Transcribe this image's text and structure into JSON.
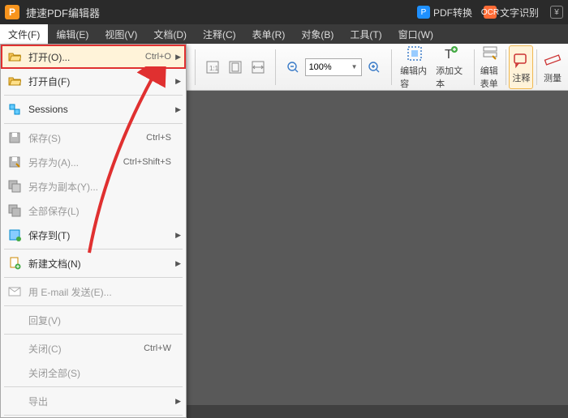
{
  "titlebar": {
    "logo": "P",
    "title": "捷速PDF编辑器",
    "pdf_convert": "PDF转换",
    "ocr": "文字识别",
    "yuan": "¥"
  },
  "menubar": {
    "items": [
      {
        "label": "文件(F)",
        "active": true
      },
      {
        "label": "编辑(E)"
      },
      {
        "label": "视图(V)"
      },
      {
        "label": "文档(D)"
      },
      {
        "label": "注释(C)"
      },
      {
        "label": "表单(R)"
      },
      {
        "label": "对象(B)"
      },
      {
        "label": "工具(T)"
      },
      {
        "label": "窗口(W)"
      }
    ]
  },
  "toolbar": {
    "zoom_value": "100%",
    "edit_content": "编辑内容",
    "add_text": "添加文本",
    "edit_form": "编辑表单",
    "annotate": "注释",
    "measure": "测量"
  },
  "dropdown": {
    "items": [
      {
        "icon": "folder-open-icon",
        "label": "打开(O)...",
        "shortcut": "Ctrl+O",
        "arrow": true,
        "highlight": true
      },
      {
        "icon": "folder-open-icon",
        "label": "打开自(F)",
        "arrow": true
      },
      {
        "sep": true
      },
      {
        "icon": "sessions-icon",
        "label": "Sessions",
        "arrow": true
      },
      {
        "sep": true
      },
      {
        "icon": "save-icon",
        "label": "保存(S)",
        "shortcut": "Ctrl+S",
        "gray": true
      },
      {
        "icon": "save-as-icon",
        "label": "另存为(A)...",
        "shortcut": "Ctrl+Shift+S",
        "gray": true
      },
      {
        "icon": "save-copy-icon",
        "label": "另存为副本(Y)...",
        "gray": true
      },
      {
        "icon": "save-all-icon",
        "label": "全部保存(L)",
        "gray": true
      },
      {
        "icon": "save-to-icon",
        "label": "保存到(T)",
        "arrow": true
      },
      {
        "sep": true
      },
      {
        "icon": "new-doc-icon",
        "label": "新建文档(N)",
        "arrow": true
      },
      {
        "sep": true
      },
      {
        "icon": "email-icon",
        "label": "用 E-mail 发送(E)...",
        "gray": true
      },
      {
        "sep": true
      },
      {
        "label": "回复(V)",
        "gray": true
      },
      {
        "sep": true
      },
      {
        "label": "关闭(C)",
        "shortcut": "Ctrl+W",
        "gray": true
      },
      {
        "label": "关闭全部(S)",
        "gray": true
      },
      {
        "sep": true
      },
      {
        "label": "导出",
        "arrow": true,
        "gray": true
      },
      {
        "sep": true
      }
    ]
  }
}
